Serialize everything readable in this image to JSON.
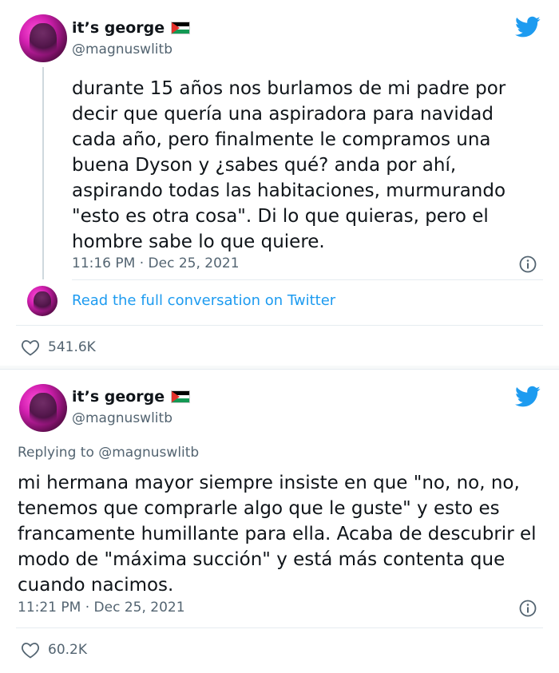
{
  "tweets": [
    {
      "author_name": "it’s george",
      "author_handle": "@magnuswlitb",
      "text": "durante 15 años nos burlamos de mi padre por decir que quería una aspiradora para navidad cada año, pero finalmente le compramos una buena Dyson y ¿sabes qué? anda por ahí, aspirando todas las habitaciones, murmurando \"esto es otra cosa\". Di lo que quieras, pero el hombre sabe lo que quiere.",
      "timestamp": "11:16 PM · Dec 25, 2021",
      "conversation_link": "Read the full conversation on Twitter",
      "likes": "541.6K"
    },
    {
      "author_name": "it’s george",
      "author_handle": "@magnuswlitb",
      "replying_to": "Replying to @magnuswlitb",
      "text": "mi hermana mayor siempre insiste en que \"no, no, no, tenemos que comprarle algo que le guste\" y esto es francamente humillante para ella. Acaba de descubrir el modo de \"máxima succión\" y está más contenta que cuando nacimos.",
      "timestamp": "11:21 PM · Dec 25, 2021",
      "likes": "60.2K"
    }
  ],
  "icons": {
    "brand": "twitter-bird-icon",
    "info": "info-icon",
    "like": "heart-icon",
    "flag": "palestine-flag-icon"
  },
  "colors": {
    "twitter_blue": "#1d9bf0",
    "text": "#0f1419",
    "muted": "#536471",
    "border": "#e6ecf0",
    "avatar_magenta": "#d21fb0"
  }
}
